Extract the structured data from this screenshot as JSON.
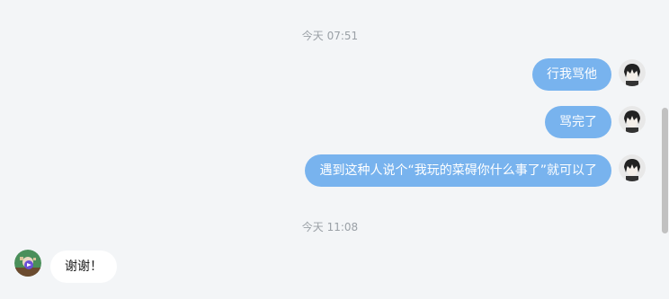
{
  "timestamps": [
    "今天 07:51",
    "今天 11:08"
  ],
  "messages_out": [
    {
      "text": "行我骂他"
    },
    {
      "text": "骂完了"
    },
    {
      "text": "遇到这种人说个“我玩的菜碍你什么事了”就可以了"
    }
  ],
  "message_in": {
    "text": "谢谢！"
  },
  "colors": {
    "background": "#f3f5f7",
    "bubble_out": "#78b3ee",
    "bubble_in": "#ffffff",
    "timestamp": "#9aa0a6"
  },
  "icons": {
    "self_avatar": "anime-character-avatar-icon",
    "other_avatar": "game-character-avatar-icon"
  }
}
